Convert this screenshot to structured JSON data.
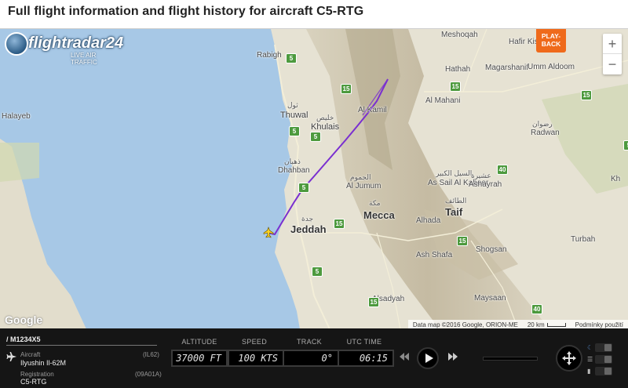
{
  "page": {
    "title": "Full flight information and flight history for aircraft C5-RTG"
  },
  "map": {
    "logo": {
      "name": "flightradar24",
      "tagline": "LIVE AIR TRAFFIC"
    },
    "playback_label": "PLAY-BACK",
    "zoom": {
      "in": "+",
      "out": "−"
    },
    "google_logo": "Google",
    "attribution": "Data map ©2016 Google, ORION-ME",
    "scale": "20 km",
    "terms": "Podmínky použití",
    "places": {
      "rabigh": "Rabigh",
      "thuwal": "Thuwal",
      "thuwal_ar": "ثول",
      "khulais": "Khulais",
      "khulais_ar": "خليص",
      "dhahban": "Dhahban",
      "dhahban_ar": "ذهبان",
      "jeddah": "Jeddah",
      "jeddah_ar": "جدة",
      "mecca": "Mecca",
      "mecca_ar": "مكة",
      "taif": "Taif",
      "taif_ar": "الطائف",
      "al_jumum": "Al Jumum",
      "al_jumum_ar": "الجموم",
      "al_kamil": "Al Kamil",
      "meshoqah": "Meshoqah",
      "hafir_kishb": "Hafir Kishb",
      "hathah": "Hathah",
      "magarshanif": "Magarshanif",
      "umm_aldoom": "Umm Aldoom",
      "al_mahani": "Al Mahani",
      "radwan": "Radwan",
      "radwan_ar": "رضوان",
      "as_sail_al_kabeer": "As Sail Al Kabeer",
      "as_sail_ar": "السيل الكبير",
      "ashayrah": "Ashayrah",
      "ashayrah_ar": "عشيرة",
      "alhada": "Alhada",
      "ash_shafa": "Ash Shafa",
      "shogsan": "Shogsan",
      "maysaan": "Maysaan",
      "alsadyah": "Alsadyah",
      "turbah": "Turbah",
      "kh": "Kh",
      "halayeb": "Halayeb"
    },
    "route_badges": [
      "5",
      "15",
      "5",
      "5",
      "5",
      "15",
      "40",
      "15",
      "5",
      "5",
      "15",
      "40",
      "15",
      "15"
    ]
  },
  "flight": {
    "callsign": "/ M1234X5",
    "aircraft_label": "Aircraft",
    "aircraft_type": "Ilyushin Il-62M",
    "aircraft_code": "(IL62)",
    "registration_label": "Registration",
    "registration": "C5-RTG",
    "registration_code": "(09A01A)"
  },
  "gauges": {
    "altitude_label": "ALTITUDE",
    "altitude": "37000 FT",
    "speed_label": "SPEED",
    "speed": "100 KTS",
    "track_label": "TRACK",
    "track": "0°",
    "time_label": "UTC TIME",
    "time": "06:15"
  },
  "colors": {
    "flight_path": "#7a2fd0",
    "sea": "#a7c8e6",
    "land": "#e6e2d3",
    "road_badge": "#4d9a3e",
    "playback": "#ef6a1b",
    "panel": "#151515"
  }
}
